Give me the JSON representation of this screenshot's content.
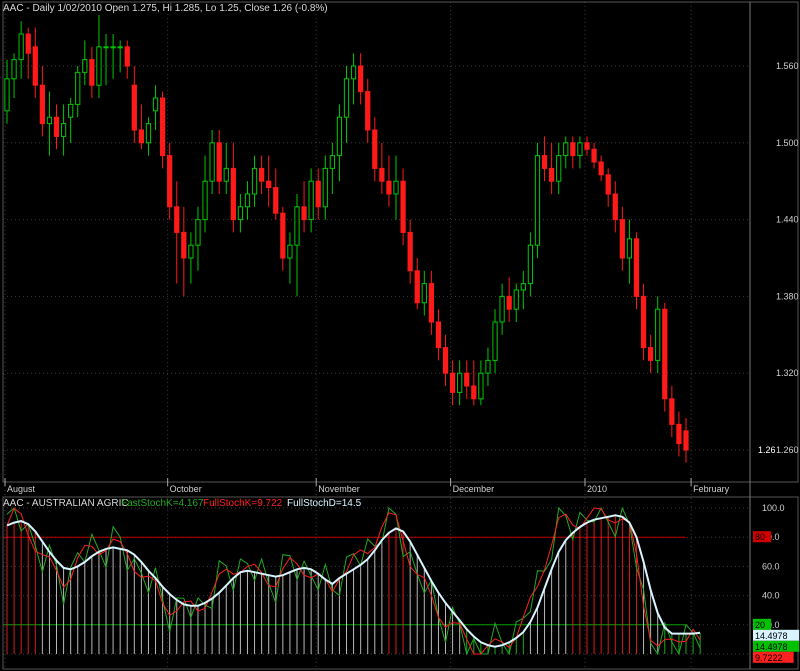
{
  "colors": {
    "background": "#000000",
    "grid": "#3a3a3a",
    "up": "#00c800",
    "down": "#ff1a1a",
    "fast_k": "#22aa22",
    "full_k": "#ff2020",
    "full_d": "#d8f4ff",
    "level_line_80": "#c00000",
    "level_line_20": "#00a000",
    "histogram": "#d8d8d8",
    "histogram_hot": "#ff2020",
    "histogram_cold": "#22cc22"
  },
  "chart_data": [
    {
      "type": "candlestick",
      "title": "AAC - Daily 1/02/2010 Open 1.275, Hi 1.285, Lo 1.25, Close 1.26 (-0.8%)",
      "x_tick_labels": [
        "August",
        "October",
        "November",
        "December",
        "2010",
        "February"
      ],
      "y_tick_labels": [
        "1.560",
        "1.500",
        "1.440",
        "1.380",
        "1.320",
        "1.260"
      ],
      "ylim": [
        1.235,
        1.61
      ],
      "last_price_label": "1.26",
      "grid": true,
      "candles": [
        [
          1.525,
          1.565,
          1.515,
          1.55
        ],
        [
          1.55,
          1.57,
          1.535,
          1.565
        ],
        [
          1.565,
          1.595,
          1.55,
          1.585
        ],
        [
          1.585,
          1.59,
          1.55,
          1.57
        ],
        [
          1.575,
          1.59,
          1.535,
          1.545
        ],
        [
          1.545,
          1.56,
          1.505,
          1.515
        ],
        [
          1.515,
          1.54,
          1.49,
          1.52
        ],
        [
          1.52,
          1.53,
          1.495,
          1.505
        ],
        [
          1.505,
          1.53,
          1.49,
          1.515
        ],
        [
          1.52,
          1.535,
          1.5,
          1.53
        ],
        [
          1.53,
          1.56,
          1.52,
          1.555
        ],
        [
          1.555,
          1.58,
          1.545,
          1.565
        ],
        [
          1.565,
          1.575,
          1.535,
          1.545
        ],
        [
          1.545,
          1.6,
          1.535,
          1.575
        ],
        [
          1.575,
          1.585,
          1.545,
          1.575
        ],
        [
          1.575,
          1.585,
          1.55,
          1.575
        ],
        [
          1.575,
          1.58,
          1.555,
          1.575
        ],
        [
          1.575,
          1.58,
          1.55,
          1.56
        ],
        [
          1.545,
          1.56,
          1.5,
          1.51
        ],
        [
          1.51,
          1.53,
          1.495,
          1.5
        ],
        [
          1.5,
          1.52,
          1.49,
          1.515
        ],
        [
          1.525,
          1.545,
          1.51,
          1.535
        ],
        [
          1.535,
          1.54,
          1.48,
          1.49
        ],
        [
          1.49,
          1.5,
          1.44,
          1.45
        ],
        [
          1.45,
          1.47,
          1.39,
          1.43
        ],
        [
          1.43,
          1.45,
          1.38,
          1.41
        ],
        [
          1.41,
          1.43,
          1.39,
          1.42
        ],
        [
          1.42,
          1.45,
          1.4,
          1.44
        ],
        [
          1.44,
          1.49,
          1.43,
          1.47
        ],
        [
          1.47,
          1.51,
          1.46,
          1.5
        ],
        [
          1.5,
          1.51,
          1.46,
          1.47
        ],
        [
          1.47,
          1.5,
          1.46,
          1.48
        ],
        [
          1.48,
          1.5,
          1.43,
          1.44
        ],
        [
          1.44,
          1.46,
          1.43,
          1.45
        ],
        [
          1.45,
          1.47,
          1.44,
          1.46
        ],
        [
          1.46,
          1.49,
          1.45,
          1.48
        ],
        [
          1.48,
          1.49,
          1.46,
          1.47
        ],
        [
          1.47,
          1.49,
          1.45,
          1.465
        ],
        [
          1.465,
          1.48,
          1.44,
          1.445
        ],
        [
          1.445,
          1.45,
          1.4,
          1.41
        ],
        [
          1.41,
          1.43,
          1.39,
          1.42
        ],
        [
          1.42,
          1.46,
          1.38,
          1.45
        ],
        [
          1.45,
          1.47,
          1.43,
          1.44
        ],
        [
          1.44,
          1.48,
          1.43,
          1.47
        ],
        [
          1.47,
          1.48,
          1.44,
          1.45
        ],
        [
          1.45,
          1.49,
          1.44,
          1.48
        ],
        [
          1.48,
          1.5,
          1.46,
          1.49
        ],
        [
          1.49,
          1.53,
          1.47,
          1.52
        ],
        [
          1.52,
          1.56,
          1.5,
          1.55
        ],
        [
          1.55,
          1.57,
          1.53,
          1.56
        ],
        [
          1.56,
          1.57,
          1.53,
          1.54
        ],
        [
          1.54,
          1.55,
          1.5,
          1.51
        ],
        [
          1.51,
          1.52,
          1.47,
          1.48
        ],
        [
          1.48,
          1.5,
          1.46,
          1.47
        ],
        [
          1.47,
          1.49,
          1.45,
          1.46
        ],
        [
          1.46,
          1.49,
          1.44,
          1.47
        ],
        [
          1.47,
          1.48,
          1.42,
          1.43
        ],
        [
          1.43,
          1.44,
          1.39,
          1.4
        ],
        [
          1.4,
          1.41,
          1.37,
          1.375
        ],
        [
          1.375,
          1.4,
          1.365,
          1.39
        ],
        [
          1.39,
          1.4,
          1.35,
          1.36
        ],
        [
          1.36,
          1.37,
          1.33,
          1.34
        ],
        [
          1.34,
          1.35,
          1.31,
          1.32
        ],
        [
          1.32,
          1.33,
          1.295,
          1.305
        ],
        [
          1.305,
          1.33,
          1.295,
          1.32
        ],
        [
          1.32,
          1.33,
          1.3,
          1.31
        ],
        [
          1.31,
          1.33,
          1.295,
          1.3
        ],
        [
          1.3,
          1.33,
          1.295,
          1.32
        ],
        [
          1.32,
          1.34,
          1.31,
          1.33
        ],
        [
          1.33,
          1.37,
          1.32,
          1.36
        ],
        [
          1.36,
          1.39,
          1.35,
          1.38
        ],
        [
          1.38,
          1.395,
          1.36,
          1.37
        ],
        [
          1.37,
          1.39,
          1.36,
          1.385
        ],
        [
          1.385,
          1.4,
          1.37,
          1.39
        ],
        [
          1.39,
          1.43,
          1.38,
          1.42
        ],
        [
          1.42,
          1.5,
          1.41,
          1.49
        ],
        [
          1.49,
          1.505,
          1.47,
          1.48
        ],
        [
          1.48,
          1.5,
          1.46,
          1.47
        ],
        [
          1.47,
          1.5,
          1.46,
          1.49
        ],
        [
          1.49,
          1.505,
          1.48,
          1.5
        ],
        [
          1.5,
          1.505,
          1.48,
          1.49
        ],
        [
          1.49,
          1.505,
          1.48,
          1.5
        ],
        [
          1.5,
          1.505,
          1.49,
          1.495
        ],
        [
          1.495,
          1.5,
          1.48,
          1.485
        ],
        [
          1.485,
          1.49,
          1.47,
          1.475
        ],
        [
          1.475,
          1.48,
          1.45,
          1.46
        ],
        [
          1.46,
          1.47,
          1.43,
          1.44
        ],
        [
          1.44,
          1.45,
          1.4,
          1.41
        ],
        [
          1.41,
          1.44,
          1.39,
          1.425
        ],
        [
          1.425,
          1.43,
          1.37,
          1.38
        ],
        [
          1.38,
          1.39,
          1.33,
          1.34
        ],
        [
          1.34,
          1.35,
          1.32,
          1.33
        ],
        [
          1.33,
          1.38,
          1.32,
          1.37
        ],
        [
          1.37,
          1.375,
          1.29,
          1.3
        ],
        [
          1.3,
          1.31,
          1.27,
          1.28
        ],
        [
          1.28,
          1.29,
          1.255,
          1.265
        ],
        [
          1.275,
          1.285,
          1.25,
          1.26
        ]
      ]
    },
    {
      "type": "line",
      "title": "AAC - AUSTRALIAN AGRIC",
      "series": [
        {
          "name": "FastStochK=4.167"
        },
        {
          "name": "FullStochK=9.722"
        },
        {
          "name": "FullStochD=14.5"
        }
      ],
      "y_tick_labels": [
        "100.0",
        "80.0",
        "60.0",
        "40.0",
        "20.0",
        "0.0"
      ],
      "ylim": [
        0,
        100
      ],
      "value_badges": [
        {
          "text": "80",
          "bg": "#d00000",
          "fg": "#000000",
          "y": 80
        },
        {
          "text": "20",
          "bg": "#00c000",
          "fg": "#000000",
          "y": 20
        },
        {
          "text": "14.4978",
          "bg": "#d8f4ff",
          "fg": "#000000",
          "y": 14.5
        },
        {
          "text": "14.4978",
          "bg": "#00c000",
          "fg": "#000000",
          "y": 9.7
        },
        {
          "text": "9.7222",
          "bg": "#ff2020",
          "fg": "#000000",
          "y": 4.5
        }
      ],
      "full_d": [
        88,
        90,
        91,
        89,
        84,
        77,
        70,
        64,
        59,
        58,
        60,
        63,
        67,
        70,
        72,
        73,
        72,
        71,
        68,
        63,
        57,
        52,
        46,
        41,
        37,
        34,
        33,
        33,
        35,
        38,
        42,
        47,
        52,
        56,
        57,
        56,
        55,
        54,
        53,
        54,
        56,
        58,
        59,
        58,
        55,
        51,
        48,
        52,
        55,
        58,
        61,
        65,
        71,
        78,
        83,
        86,
        84,
        77,
        68,
        59,
        50,
        42,
        35,
        29,
        23,
        17,
        12,
        8,
        6,
        5,
        6,
        8,
        11,
        15,
        22,
        32,
        45,
        58,
        70,
        78,
        83,
        87,
        90,
        92,
        93,
        94,
        95,
        94,
        90,
        80,
        63,
        44,
        28,
        18,
        14,
        14,
        14,
        14,
        14.5
      ]
    }
  ]
}
